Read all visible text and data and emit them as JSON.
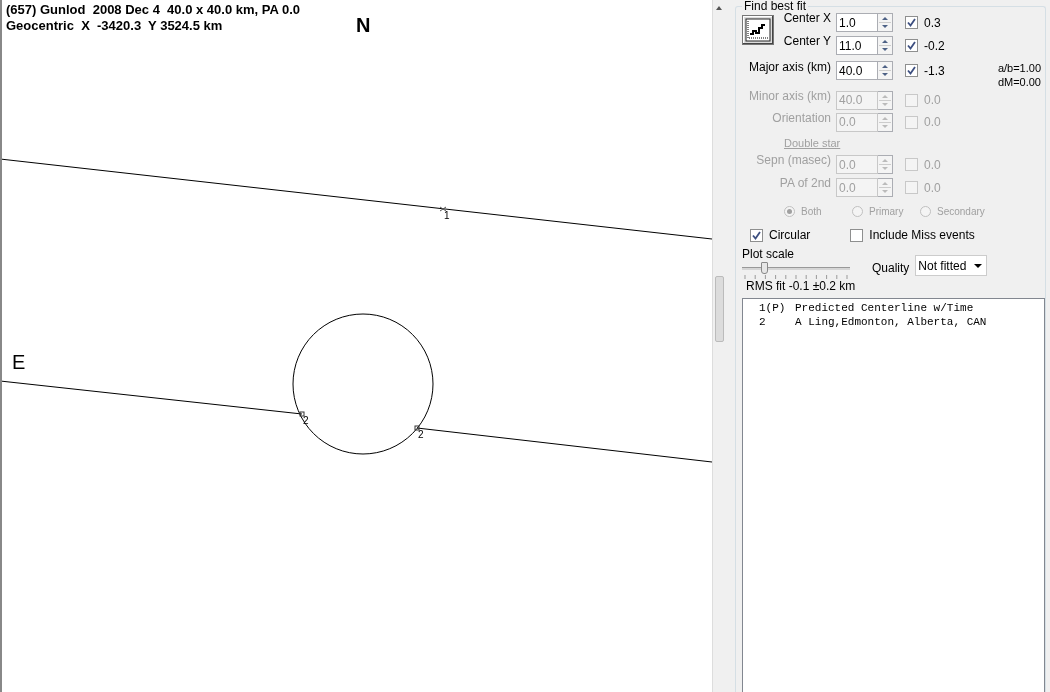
{
  "plot": {
    "title": "(657) Gunlod  2008 Dec 4  40.0 x 40.0 km, PA 0.0",
    "subtitle": "Geocentric  X  -3420.3  Y 3524.5 km",
    "north_label": "N",
    "east_label": "E",
    "markers": [
      {
        "label": "1",
        "kind": "cross"
      },
      {
        "label": "2",
        "kind": "square"
      },
      {
        "label": "2",
        "kind": "square"
      }
    ]
  },
  "fit": {
    "title": "Find best fit",
    "parameters": [
      {
        "label": "Center X",
        "value": "1.0",
        "fitted": true,
        "delta": "0.3",
        "disabled": false
      },
      {
        "label": "Center Y",
        "value": "11.0",
        "fitted": true,
        "delta": "-0.2",
        "disabled": false
      },
      {
        "label": "Major axis (km)",
        "value": "40.0",
        "fitted": true,
        "delta": "-1.3",
        "disabled": false
      },
      {
        "label": "Minor axis (km)",
        "value": "40.0",
        "fitted": false,
        "delta": "0.0",
        "disabled": true
      },
      {
        "label": "Orientation",
        "value": "0.0",
        "fitted": false,
        "delta": "0.0",
        "disabled": true
      }
    ],
    "ratio": "a/b=1.00",
    "dm": "dM=0.00",
    "double_star": {
      "label": "Double star",
      "disabled": true,
      "parameters": [
        {
          "label": "Sepn (masec)",
          "value": "0.0",
          "fitted": false,
          "delta": "0.0",
          "disabled": true
        },
        {
          "label": "PA of 2nd",
          "value": "0.0",
          "fitted": false,
          "delta": "0.0",
          "disabled": true
        }
      ],
      "components": [
        {
          "label": "Both",
          "selected": true
        },
        {
          "label": "Primary",
          "selected": false
        },
        {
          "label": "Secondary",
          "selected": false
        }
      ]
    },
    "circular": {
      "label": "Circular",
      "checked": true
    },
    "include_miss": {
      "label": "Include Miss events",
      "checked": false
    },
    "plot_scale": {
      "label": "Plot scale",
      "level": 0.2
    },
    "quality": {
      "label": "Quality",
      "value": "Not fitted"
    },
    "rms": "RMS fit -0.1 ±0.2 km",
    "events": [
      {
        "number": "1(P)",
        "text": "Predicted Centerline w/Time"
      },
      {
        "number": "2",
        "text": "A Ling,Edmonton, Alberta, CAN"
      }
    ]
  }
}
